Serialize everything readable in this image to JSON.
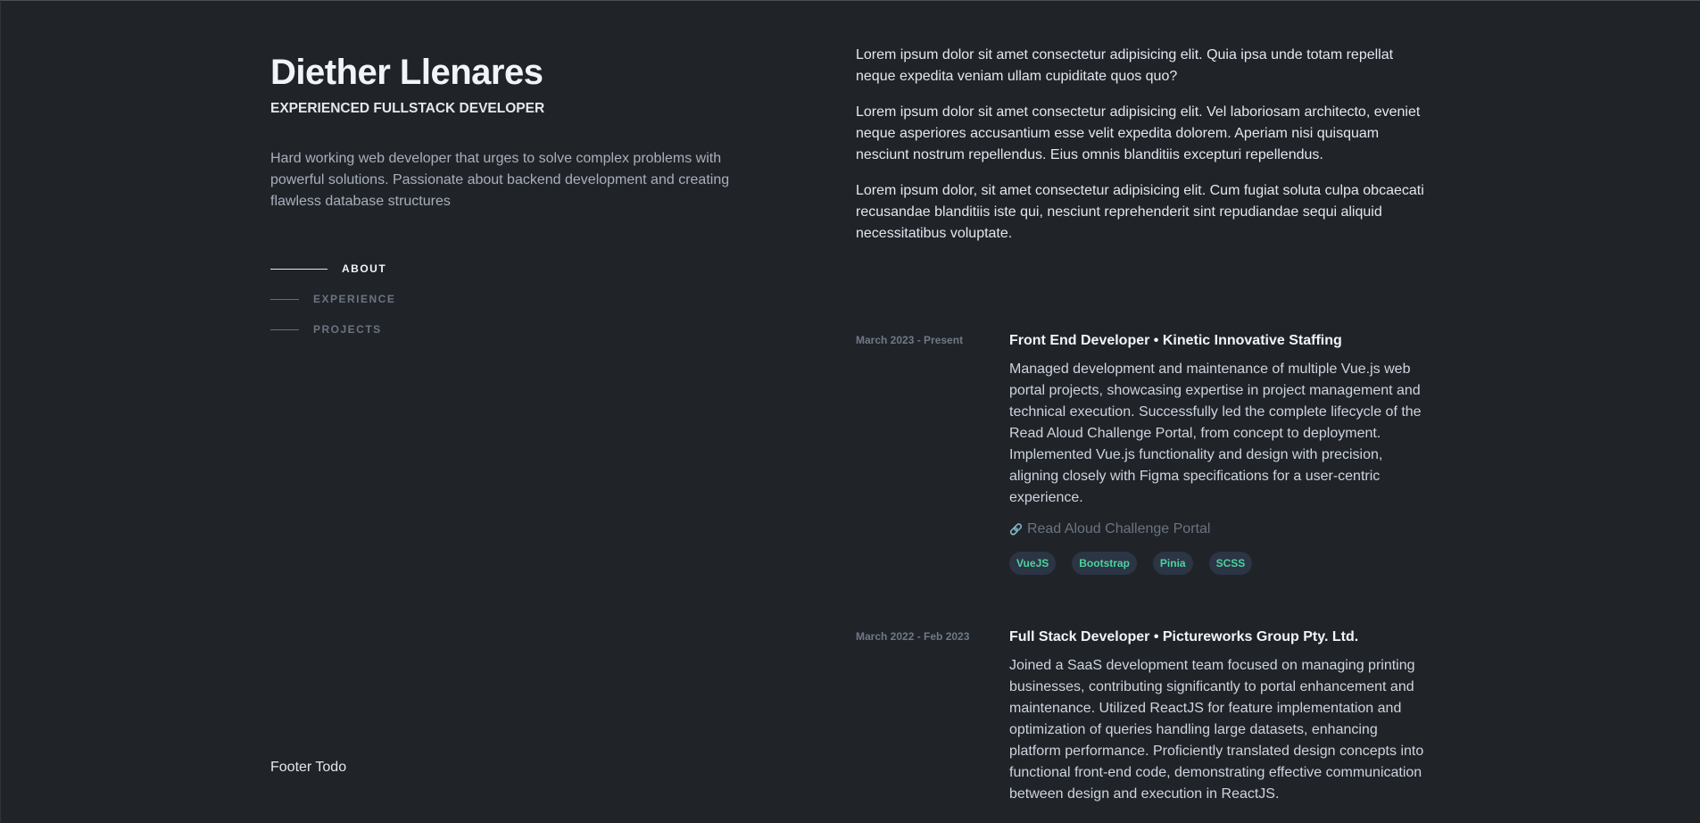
{
  "profile": {
    "name": "Diether Llenares",
    "role": "EXPERIENCED FULLSTACK DEVELOPER",
    "summary": "Hard working web developer that urges to solve complex problems with powerful solutions. Passionate about backend development and creating flawless database structures"
  },
  "nav": {
    "items": [
      {
        "label": "ABOUT",
        "active": true
      },
      {
        "label": "EXPERIENCE",
        "active": false
      },
      {
        "label": "PROJECTS",
        "active": false
      }
    ]
  },
  "footer": {
    "text": "Footer Todo"
  },
  "about": {
    "paragraphs": [
      "Lorem ipsum dolor sit amet consectetur adipisicing elit. Quia ipsa unde totam repellat neque expedita veniam ullam cupiditate quos quo?",
      "Lorem ipsum dolor sit amet consectetur adipisicing elit. Vel laboriosam architecto, eveniet neque asperiores accusantium esse velit expedita dolorem. Aperiam nisi quisquam nesciunt nostrum repellendus. Eius omnis blanditiis excepturi repellendus.",
      "Lorem ipsum dolor, sit amet consectetur adipisicing elit. Cum fugiat soluta culpa obcaecati recusandae blanditiis iste qui, nesciunt reprehenderit sint repudiandae sequi aliquid necessitatibus voluptate."
    ]
  },
  "experience": [
    {
      "date": "March 2023 - Present",
      "title": "Front End Developer • Kinetic Innovative Staffing",
      "description": "Managed development and maintenance of multiple Vue.js web portal projects, showcasing expertise in project management and technical execution. Successfully led the complete lifecycle of the Read Aloud Challenge Portal, from concept to deployment. Implemented Vue.js functionality and design with precision, aligning closely with Figma specifications for a user-centric experience.",
      "link": {
        "icon": "link-icon",
        "label": "Read Aloud Challenge Portal"
      },
      "tags": [
        "VueJS",
        "Bootstrap",
        "Pinia",
        "SCSS"
      ]
    },
    {
      "date": "March 2022 - Feb 2023",
      "title": "Full Stack Developer • Pictureworks Group Pty. Ltd.",
      "description": "Joined a SaaS development team focused on managing printing businesses, contributing significantly to portal enhancement and maintenance. Utilized ReactJS for feature implementation and optimization of queries handling large datasets, enhancing platform performance. Proficiently translated design concepts into functional front-end code, demonstrating effective communication between design and execution in ReactJS."
    }
  ],
  "colors": {
    "background": "#202328",
    "tag_text": "#4ed1a0",
    "tag_background": "#2b3544"
  }
}
